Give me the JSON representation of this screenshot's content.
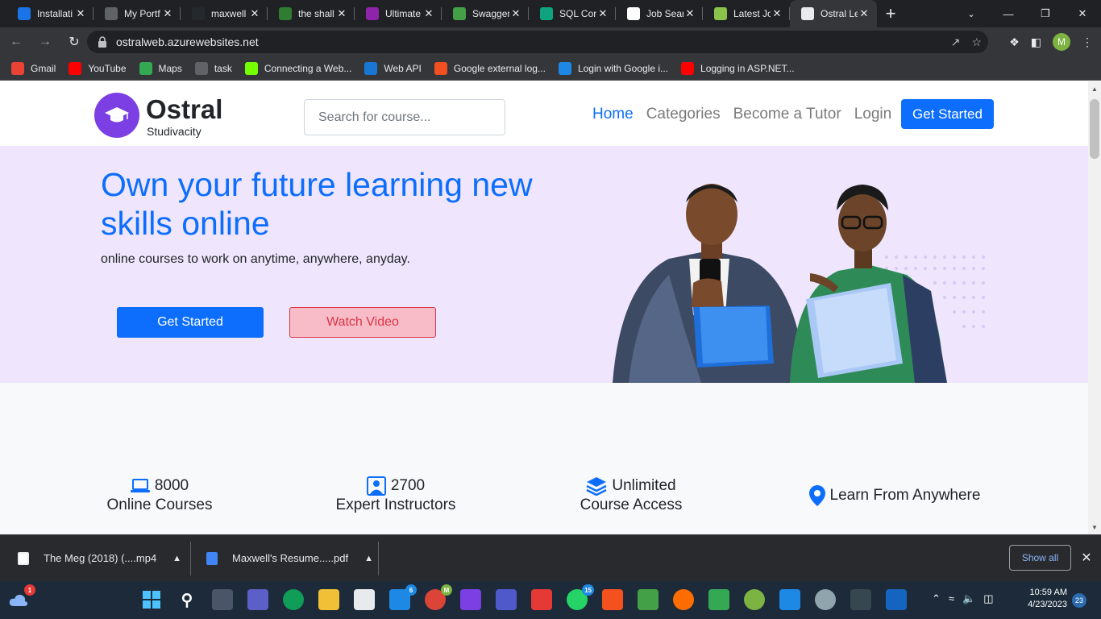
{
  "browser": {
    "tabs": [
      {
        "title": "Installati",
        "icon": "azure-icon",
        "color": "#1a73e8"
      },
      {
        "title": "My Portf",
        "icon": "person-icon",
        "color": "#5f6368"
      },
      {
        "title": "maxwell",
        "icon": "github-icon",
        "color": "#24292e"
      },
      {
        "title": "the shall",
        "icon": "n-icon",
        "color": "#2e7d32"
      },
      {
        "title": "Ultimate",
        "icon": "u-icon",
        "color": "#8e24aa"
      },
      {
        "title": "Swagger",
        "icon": "swagger-icon",
        "color": "#43a047"
      },
      {
        "title": "SQL Con",
        "icon": "openai-icon",
        "color": "#10a37f"
      },
      {
        "title": "Job Sear",
        "icon": "info-icon",
        "color": "#ffffff"
      },
      {
        "title": "Latest Jo",
        "icon": "upwork-icon",
        "color": "#8bc34a"
      },
      {
        "title": "Ostral Le",
        "icon": "page-icon",
        "color": "#e8eaed",
        "active": true
      }
    ],
    "url": "ostralweb.azurewebsites.net",
    "profile_initial": "M",
    "bookmarks": [
      {
        "label": "Gmail",
        "icon": "gmail-icon",
        "color": "#ea4335"
      },
      {
        "label": "YouTube",
        "icon": "youtube-icon",
        "color": "#ff0000"
      },
      {
        "label": "Maps",
        "icon": "maps-icon",
        "color": "#34a853"
      },
      {
        "label": "task",
        "icon": "globe-icon",
        "color": "#5f6368"
      },
      {
        "label": "Connecting a Web...",
        "icon": "stack-icon",
        "color": "#76ff03"
      },
      {
        "label": "Web API",
        "icon": "webapi-icon",
        "color": "#1976d2"
      },
      {
        "label": "Google external log...",
        "icon": "microsoft-icon",
        "color": "#f25022"
      },
      {
        "label": "Login with Google i...",
        "icon": "asp-icon",
        "color": "#1e88e5"
      },
      {
        "label": "Logging in ASP.NET...",
        "icon": "youtube-icon",
        "color": "#ff0000"
      }
    ]
  },
  "site": {
    "brand_name": "Ostral",
    "brand_sub": "Studivacity",
    "search_placeholder": "Search for course...",
    "nav": [
      {
        "label": "Home",
        "active": true
      },
      {
        "label": "Categories"
      },
      {
        "label": "Become a Tutor"
      },
      {
        "label": "Login"
      }
    ],
    "header_cta": "Get Started",
    "hero": {
      "title": "Own your future learning new skills online",
      "subtitle": "online courses to work on anytime, anywhere, anyday.",
      "primary_btn": "Get Started",
      "secondary_btn": "Watch Video"
    },
    "features": [
      {
        "icon": "laptop-icon",
        "line1": "8000",
        "line2": "Online Courses"
      },
      {
        "icon": "user-badge-icon",
        "line1": "2700",
        "line2": "Expert Instructors"
      },
      {
        "icon": "layers-icon",
        "line1": "Unlimited",
        "line2": "Course Access"
      },
      {
        "icon": "location-pin-icon",
        "line1": "Learn From Anywhere",
        "line2": ""
      }
    ],
    "accent_color": "#0d6efd",
    "brand_color": "#7b3fe4",
    "hero_bg": "#efe6fd"
  },
  "downloads": {
    "items": [
      {
        "name": "The Meg (2018) (....mp4",
        "icon": "video-file-icon"
      },
      {
        "name": "Maxwell's Resume.....pdf",
        "icon": "doc-file-icon"
      }
    ],
    "show_all": "Show all"
  },
  "taskbar": {
    "time": "10:59 AM",
    "date": "4/23/2023",
    "notifications": "23",
    "weather_badge": "1",
    "mail_badge": "6",
    "whatsapp_badge": "15",
    "chrome_profile": "M"
  }
}
